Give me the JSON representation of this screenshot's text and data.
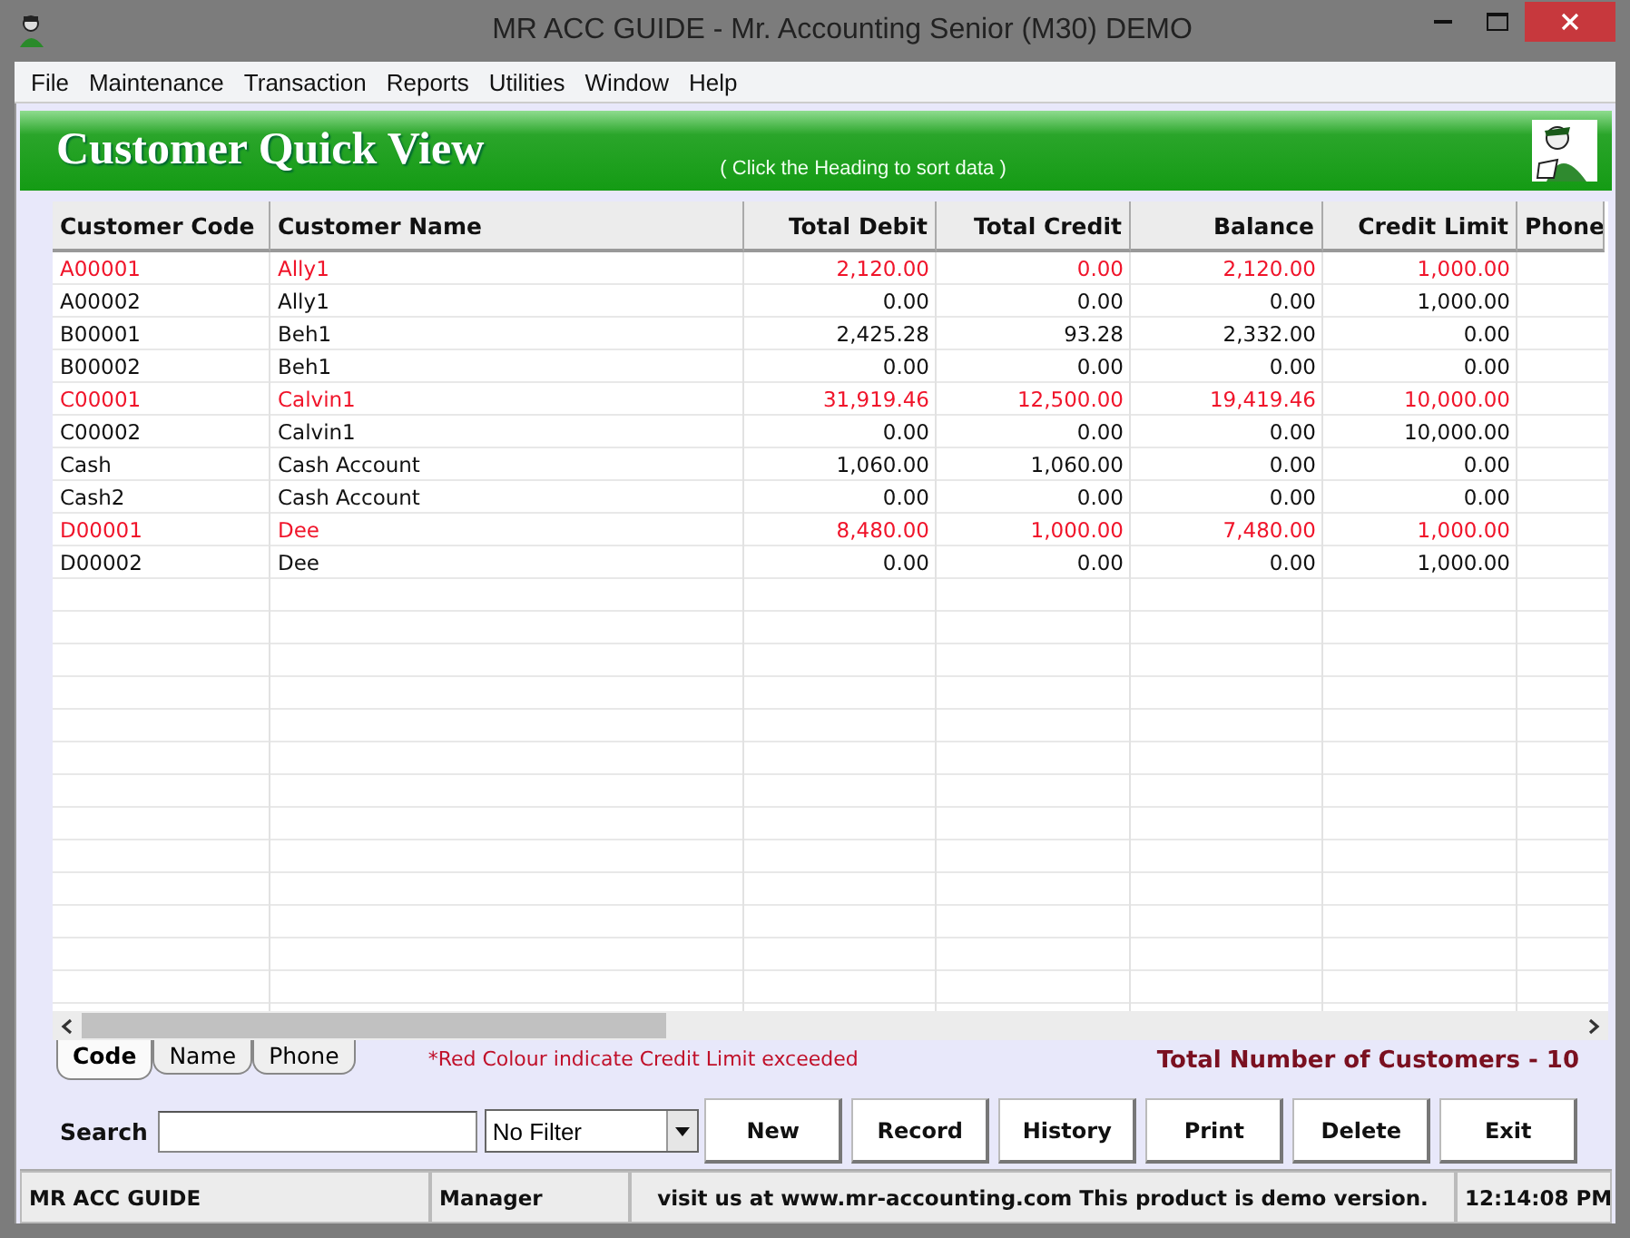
{
  "window": {
    "title": "MR ACC GUIDE - Mr. Accounting Senior (M30) DEMO"
  },
  "menu": [
    "File",
    "Maintenance",
    "Transaction",
    "Reports",
    "Utilities",
    "Window",
    "Help"
  ],
  "header": {
    "title": "Customer Quick View",
    "hint": "( Click the Heading to sort data )"
  },
  "table": {
    "columns": [
      "Customer Code",
      "Customer Name",
      "Total Debit",
      "Total Credit",
      "Balance",
      "Credit Limit",
      "Phone"
    ],
    "rows": [
      {
        "exceeded": true,
        "cells": [
          "A00001",
          "Ally1",
          "2,120.00",
          "0.00",
          "2,120.00",
          "1,000.00"
        ]
      },
      {
        "exceeded": false,
        "cells": [
          "A00002",
          "Ally1",
          "0.00",
          "0.00",
          "0.00",
          "1,000.00"
        ]
      },
      {
        "exceeded": false,
        "cells": [
          "B00001",
          "Beh1",
          "2,425.28",
          "93.28",
          "2,332.00",
          "0.00"
        ]
      },
      {
        "exceeded": false,
        "cells": [
          "B00002",
          "Beh1",
          "0.00",
          "0.00",
          "0.00",
          "0.00"
        ]
      },
      {
        "exceeded": true,
        "cells": [
          "C00001",
          "Calvin1",
          "31,919.46",
          "12,500.00",
          "19,419.46",
          "10,000.00"
        ]
      },
      {
        "exceeded": false,
        "cells": [
          "C00002",
          "Calvin1",
          "0.00",
          "0.00",
          "0.00",
          "10,000.00"
        ]
      },
      {
        "exceeded": false,
        "cells": [
          "Cash",
          "Cash Account",
          "1,060.00",
          "1,060.00",
          "0.00",
          "0.00"
        ]
      },
      {
        "exceeded": false,
        "cells": [
          "Cash2",
          "Cash Account",
          "0.00",
          "0.00",
          "0.00",
          "0.00"
        ]
      },
      {
        "exceeded": true,
        "cells": [
          "D00001",
          "Dee",
          "8,480.00",
          "1,000.00",
          "7,480.00",
          "1,000.00"
        ]
      },
      {
        "exceeded": false,
        "cells": [
          "D00002",
          "Dee",
          "0.00",
          "0.00",
          "0.00",
          "1,000.00"
        ]
      }
    ]
  },
  "sort_tabs": [
    {
      "label": "Code",
      "selected": true
    },
    {
      "label": "Name",
      "selected": false
    },
    {
      "label": "Phone",
      "selected": false
    }
  ],
  "note": "*Red Colour indicate Credit Limit exceeded",
  "total": "Total Number of Customers - 10",
  "search": {
    "label": "Search",
    "filter": "No Filter"
  },
  "buttons": [
    "New",
    "Record",
    "History",
    "Print",
    "Delete",
    "Exit"
  ],
  "status_bar": [
    "MR ACC GUIDE",
    "Manager",
    "visit us at www.mr-accounting.com This product is demo version.",
    "12:14:08 PM"
  ]
}
